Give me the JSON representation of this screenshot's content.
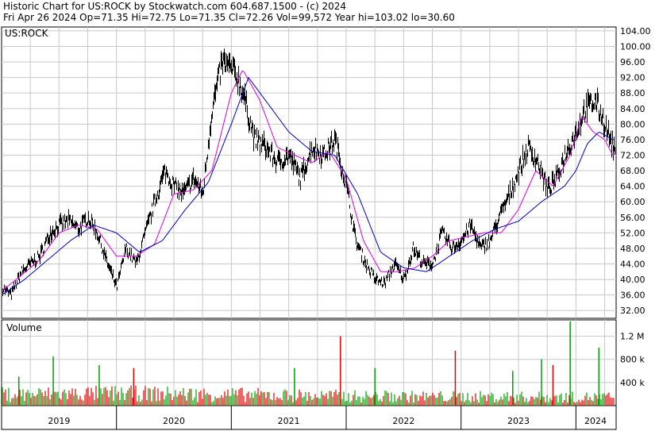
{
  "header": {
    "line1": "Historic Chart for US:ROCK by Stockwatch.com 604.687.1500 - (c) 2024",
    "line2": "Fri Apr 26 2024   Op=71.35   Hi=72.75   Lo=71.35   Cl=72.26   Vol=99,572   Year hi=103.02   lo=30.60"
  },
  "chart_data": {
    "type": "line",
    "price_panel": {
      "label": "US:ROCK",
      "ylim": [
        30,
        105
      ],
      "y_ticks": [
        104.0,
        100.0,
        96.0,
        92.0,
        88.0,
        84.0,
        80.0,
        76.0,
        72.0,
        68.0,
        64.0,
        60.0,
        56.0,
        52.0,
        48.0,
        44.0,
        40.0,
        36.0,
        32.0
      ],
      "y_tick_labels": [
        "104.00",
        "100.00",
        "96.00",
        "92.00",
        "88.00",
        "84.00",
        "80.00",
        "76.00",
        "72.00",
        "68.00",
        "64.00",
        "60.00",
        "56.00",
        "52.00",
        "48.00",
        "44.00",
        "40.00",
        "36.00",
        "32.00"
      ],
      "grid": true,
      "series": [
        {
          "style": "high-low bars",
          "color": "#000000",
          "x": [
            2019.0,
            2019.08,
            2019.17,
            2019.25,
            2019.33,
            2019.42,
            2019.5,
            2019.58,
            2019.67,
            2019.75,
            2019.83,
            2019.92,
            2020.0,
            2020.08,
            2020.17,
            2020.25,
            2020.33,
            2020.42,
            2020.5,
            2020.58,
            2020.67,
            2020.75,
            2020.83,
            2020.92,
            2021.0,
            2021.05,
            2021.1,
            2021.2,
            2021.3,
            2021.4,
            2021.5,
            2021.6,
            2021.7,
            2021.8,
            2021.9,
            2022.0,
            2022.08,
            2022.17,
            2022.25,
            2022.33,
            2022.42,
            2022.5,
            2022.58,
            2022.67,
            2022.75,
            2022.83,
            2022.92,
            2023.0,
            2023.08,
            2023.17,
            2023.25,
            2023.33,
            2023.42,
            2023.5,
            2023.58,
            2023.67,
            2023.75,
            2023.83,
            2023.9,
            2024.0,
            2024.08,
            2024.17,
            2024.25,
            2024.32
          ],
          "values": [
            38,
            36,
            42,
            44,
            46,
            52,
            54,
            55,
            53,
            56,
            52,
            44,
            38,
            48,
            44,
            52,
            60,
            68,
            64,
            62,
            66,
            62,
            84,
            96,
            94,
            92,
            88,
            76,
            74,
            70,
            72,
            66,
            74,
            72,
            76,
            64,
            50,
            44,
            40,
            39,
            44,
            40,
            48,
            44,
            44,
            52,
            48,
            50,
            54,
            48,
            50,
            56,
            62,
            68,
            74,
            70,
            63,
            66,
            72,
            78,
            84,
            86,
            80,
            74
          ]
        },
        {
          "style": "short moving average",
          "color": "#e000e0",
          "x": [
            2019.0,
            2019.17,
            2019.33,
            2019.5,
            2019.67,
            2019.83,
            2020.0,
            2020.17,
            2020.33,
            2020.5,
            2020.67,
            2020.83,
            2021.0,
            2021.1,
            2021.25,
            2021.4,
            2021.55,
            2021.7,
            2021.85,
            2022.0,
            2022.15,
            2022.3,
            2022.45,
            2022.6,
            2022.75,
            2022.9,
            2023.05,
            2023.2,
            2023.35,
            2023.5,
            2023.65,
            2023.8,
            2023.95,
            2024.05,
            2024.15,
            2024.25,
            2024.32
          ],
          "values": [
            37,
            41,
            45,
            52,
            54,
            53,
            46,
            46,
            49,
            62,
            63,
            68,
            88,
            94,
            86,
            74,
            72,
            70,
            73,
            66,
            50,
            42,
            42,
            43,
            46,
            50,
            51,
            52,
            52,
            58,
            68,
            64,
            72,
            82,
            78,
            76,
            72
          ]
        },
        {
          "style": "long moving average",
          "color": "#0000c0",
          "x": [
            2019.0,
            2019.2,
            2019.4,
            2019.6,
            2019.8,
            2020.0,
            2020.2,
            2020.4,
            2020.6,
            2020.8,
            2021.0,
            2021.15,
            2021.3,
            2021.5,
            2021.7,
            2021.9,
            2022.1,
            2022.3,
            2022.5,
            2022.7,
            2022.9,
            2023.1,
            2023.3,
            2023.5,
            2023.7,
            2023.9,
            2024.0,
            2024.1,
            2024.2,
            2024.32
          ],
          "values": [
            36,
            40,
            45,
            50,
            54,
            52,
            47,
            50,
            58,
            65,
            80,
            92,
            86,
            78,
            73,
            72,
            62,
            47,
            43,
            42,
            46,
            50,
            53,
            55,
            60,
            64,
            68,
            75,
            78,
            76
          ]
        }
      ]
    },
    "volume_panel": {
      "label": "Volume",
      "ylim": [
        0,
        1400000
      ],
      "y_ticks": [
        1200000,
        800000,
        400000
      ],
      "y_tick_labels": [
        "1.2 M",
        "800 k",
        "400 k"
      ],
      "colors": {
        "up": "#00a000",
        "down": "#e00000"
      },
      "spikes": [
        {
          "x": 2019.15,
          "value": 500000,
          "dir": "up"
        },
        {
          "x": 2019.45,
          "value": 850000,
          "dir": "up"
        },
        {
          "x": 2019.85,
          "value": 700000,
          "dir": "up"
        },
        {
          "x": 2020.15,
          "value": 650000,
          "dir": "down"
        },
        {
          "x": 2021.55,
          "value": 650000,
          "dir": "up"
        },
        {
          "x": 2021.95,
          "value": 1200000,
          "dir": "down"
        },
        {
          "x": 2022.25,
          "value": 650000,
          "dir": "up"
        },
        {
          "x": 2022.95,
          "value": 950000,
          "dir": "down"
        },
        {
          "x": 2023.45,
          "value": 600000,
          "dir": "up"
        },
        {
          "x": 2023.7,
          "value": 800000,
          "dir": "up"
        },
        {
          "x": 2023.8,
          "value": 700000,
          "dir": "down"
        },
        {
          "x": 2023.95,
          "value": 1550000,
          "dir": "up"
        },
        {
          "x": 2024.2,
          "value": 1000000,
          "dir": "up"
        }
      ],
      "baseline": [
        {
          "x": 2019.0,
          "value": 200000
        },
        {
          "x": 2020.0,
          "value": 220000
        },
        {
          "x": 2021.0,
          "value": 200000
        },
        {
          "x": 2022.0,
          "value": 170000
        },
        {
          "x": 2023.0,
          "value": 160000
        },
        {
          "x": 2024.0,
          "value": 150000
        }
      ]
    },
    "x_axis": {
      "xlim": [
        2019.0,
        2024.35
      ],
      "years": [
        {
          "label": "2019",
          "start": 2019.0
        },
        {
          "label": "2020",
          "start": 2020.0
        },
        {
          "label": "2021",
          "start": 2021.0
        },
        {
          "label": "2022",
          "start": 2022.0
        },
        {
          "label": "2023",
          "start": 2023.0
        },
        {
          "label": "2024",
          "start": 2024.0
        }
      ],
      "year_label_centers": [
        2019.5,
        2020.5,
        2021.5,
        2022.5,
        2023.5,
        2024.17
      ]
    }
  }
}
